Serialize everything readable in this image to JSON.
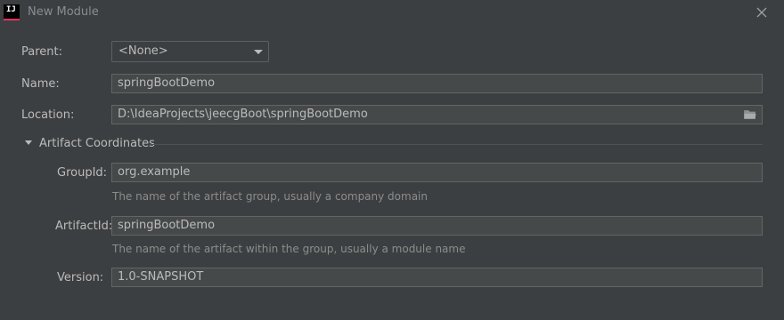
{
  "window": {
    "title": "New Module",
    "logo_text": "IJ"
  },
  "form": {
    "parent": {
      "label": "Parent:",
      "value": "<None>"
    },
    "name": {
      "label": "Name:",
      "value": "springBootDemo"
    },
    "location": {
      "label": "Location:",
      "value": "D:\\IdeaProjects\\jeecgBoot\\springBootDemo"
    }
  },
  "artifact": {
    "section_title": "Artifact Coordinates",
    "group_id": {
      "label": "GroupId:",
      "value": "org.example",
      "hint": "The name of the artifact group, usually a company domain"
    },
    "artifact_id": {
      "label": "ArtifactId:",
      "value": "springBootDemo",
      "hint": "The name of the artifact within the group, usually a module name"
    },
    "version": {
      "label": "Version:",
      "value": "1.0-SNAPSHOT"
    }
  },
  "icons": {
    "app": "intellij-logo-icon",
    "close": "close-icon",
    "dropdown": "chevron-down-icon",
    "browse": "folder-icon",
    "toggle": "expand-triangle-icon"
  },
  "colors": {
    "background": "#3c3f41",
    "field_background": "#45494a",
    "text": "#bbbbbb",
    "hint_text": "#8c8c8c",
    "logo_accent": "#fe315d"
  }
}
